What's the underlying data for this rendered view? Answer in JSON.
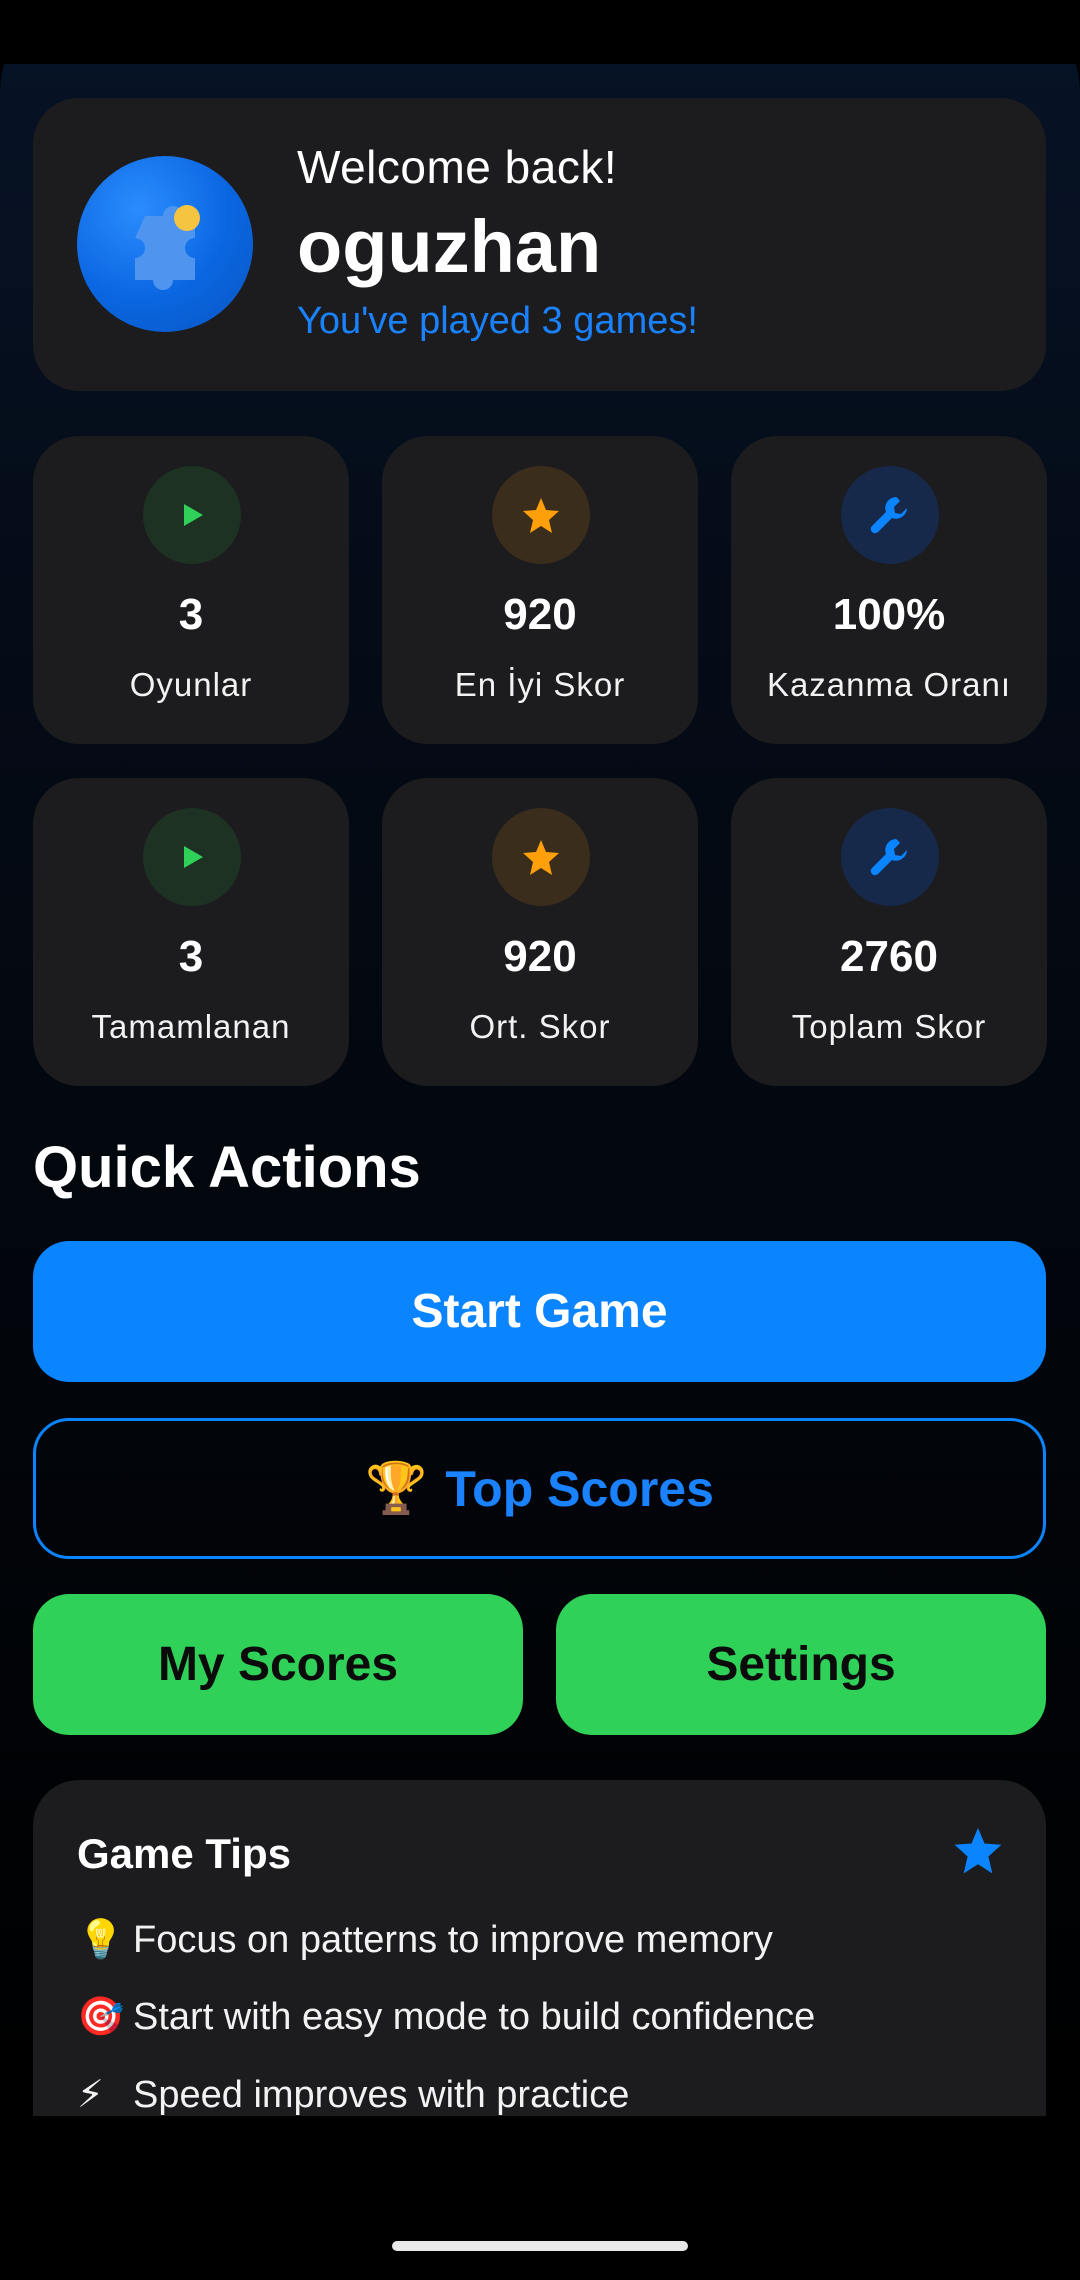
{
  "welcome": {
    "greeting": "Welcome back!",
    "username": "oguzhan",
    "games_played": "You've played 3 games!",
    "avatar_icon": "puzzle-icon"
  },
  "stats": [
    {
      "value": "3",
      "label": "Oyunlar",
      "icon": "play-icon",
      "color": "#30d158"
    },
    {
      "value": "920",
      "label": "En İyi Skor",
      "icon": "star-icon",
      "color": "#ff9f0a"
    },
    {
      "value": "100%",
      "label": "Kazanma Oranı",
      "icon": "wrench-icon",
      "color": "#0a84ff"
    },
    {
      "value": "3",
      "label": "Tamamlanan",
      "icon": "play-icon",
      "color": "#30d158"
    },
    {
      "value": "920",
      "label": "Ort. Skor",
      "icon": "star-icon",
      "color": "#ff9f0a"
    },
    {
      "value": "2760",
      "label": "Toplam Skor",
      "icon": "wrench-icon",
      "color": "#0a84ff"
    }
  ],
  "quick_actions": {
    "title": "Quick Actions",
    "start_game": "Start Game",
    "top_scores_icon": "🏆",
    "top_scores": "Top Scores",
    "my_scores": "My Scores",
    "settings": "Settings"
  },
  "tips": {
    "title": "Game Tips",
    "icon": "star-icon",
    "items": [
      {
        "emoji": "💡",
        "text": "Focus on patterns to improve memory"
      },
      {
        "emoji": "🎯",
        "text": "Start with easy mode to build confidence"
      },
      {
        "emoji": "⚡",
        "text": "Speed improves with practice"
      }
    ]
  },
  "colors": {
    "accent": "#0a84ff",
    "success": "#30d158",
    "warning": "#ff9f0a",
    "card": "#1c1c1e"
  }
}
